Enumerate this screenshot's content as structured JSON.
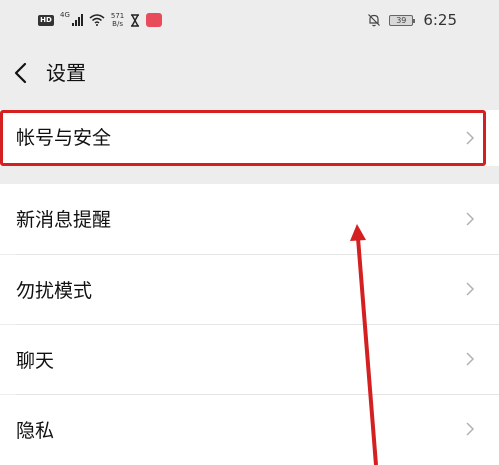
{
  "status_bar": {
    "hd_label": "HD",
    "network_type": "4G",
    "speed_value": "571",
    "speed_unit": "B/s",
    "battery_level": "39",
    "time": "6:25",
    "icons": [
      "hd-icon",
      "signal-icon",
      "wifi-icon",
      "hourglass-icon",
      "app-notification-icon",
      "mute-bell-icon",
      "battery-icon"
    ]
  },
  "header": {
    "title": "设置",
    "back_icon": "chevron-left-icon"
  },
  "settings": {
    "items": [
      {
        "label": "帐号与安全"
      },
      {
        "label": "新消息提醒"
      },
      {
        "label": "勿扰模式"
      },
      {
        "label": "聊天"
      },
      {
        "label": "隐私"
      }
    ]
  },
  "annotation": {
    "highlight_color": "#d42020",
    "arrow_color": "#d42020"
  }
}
